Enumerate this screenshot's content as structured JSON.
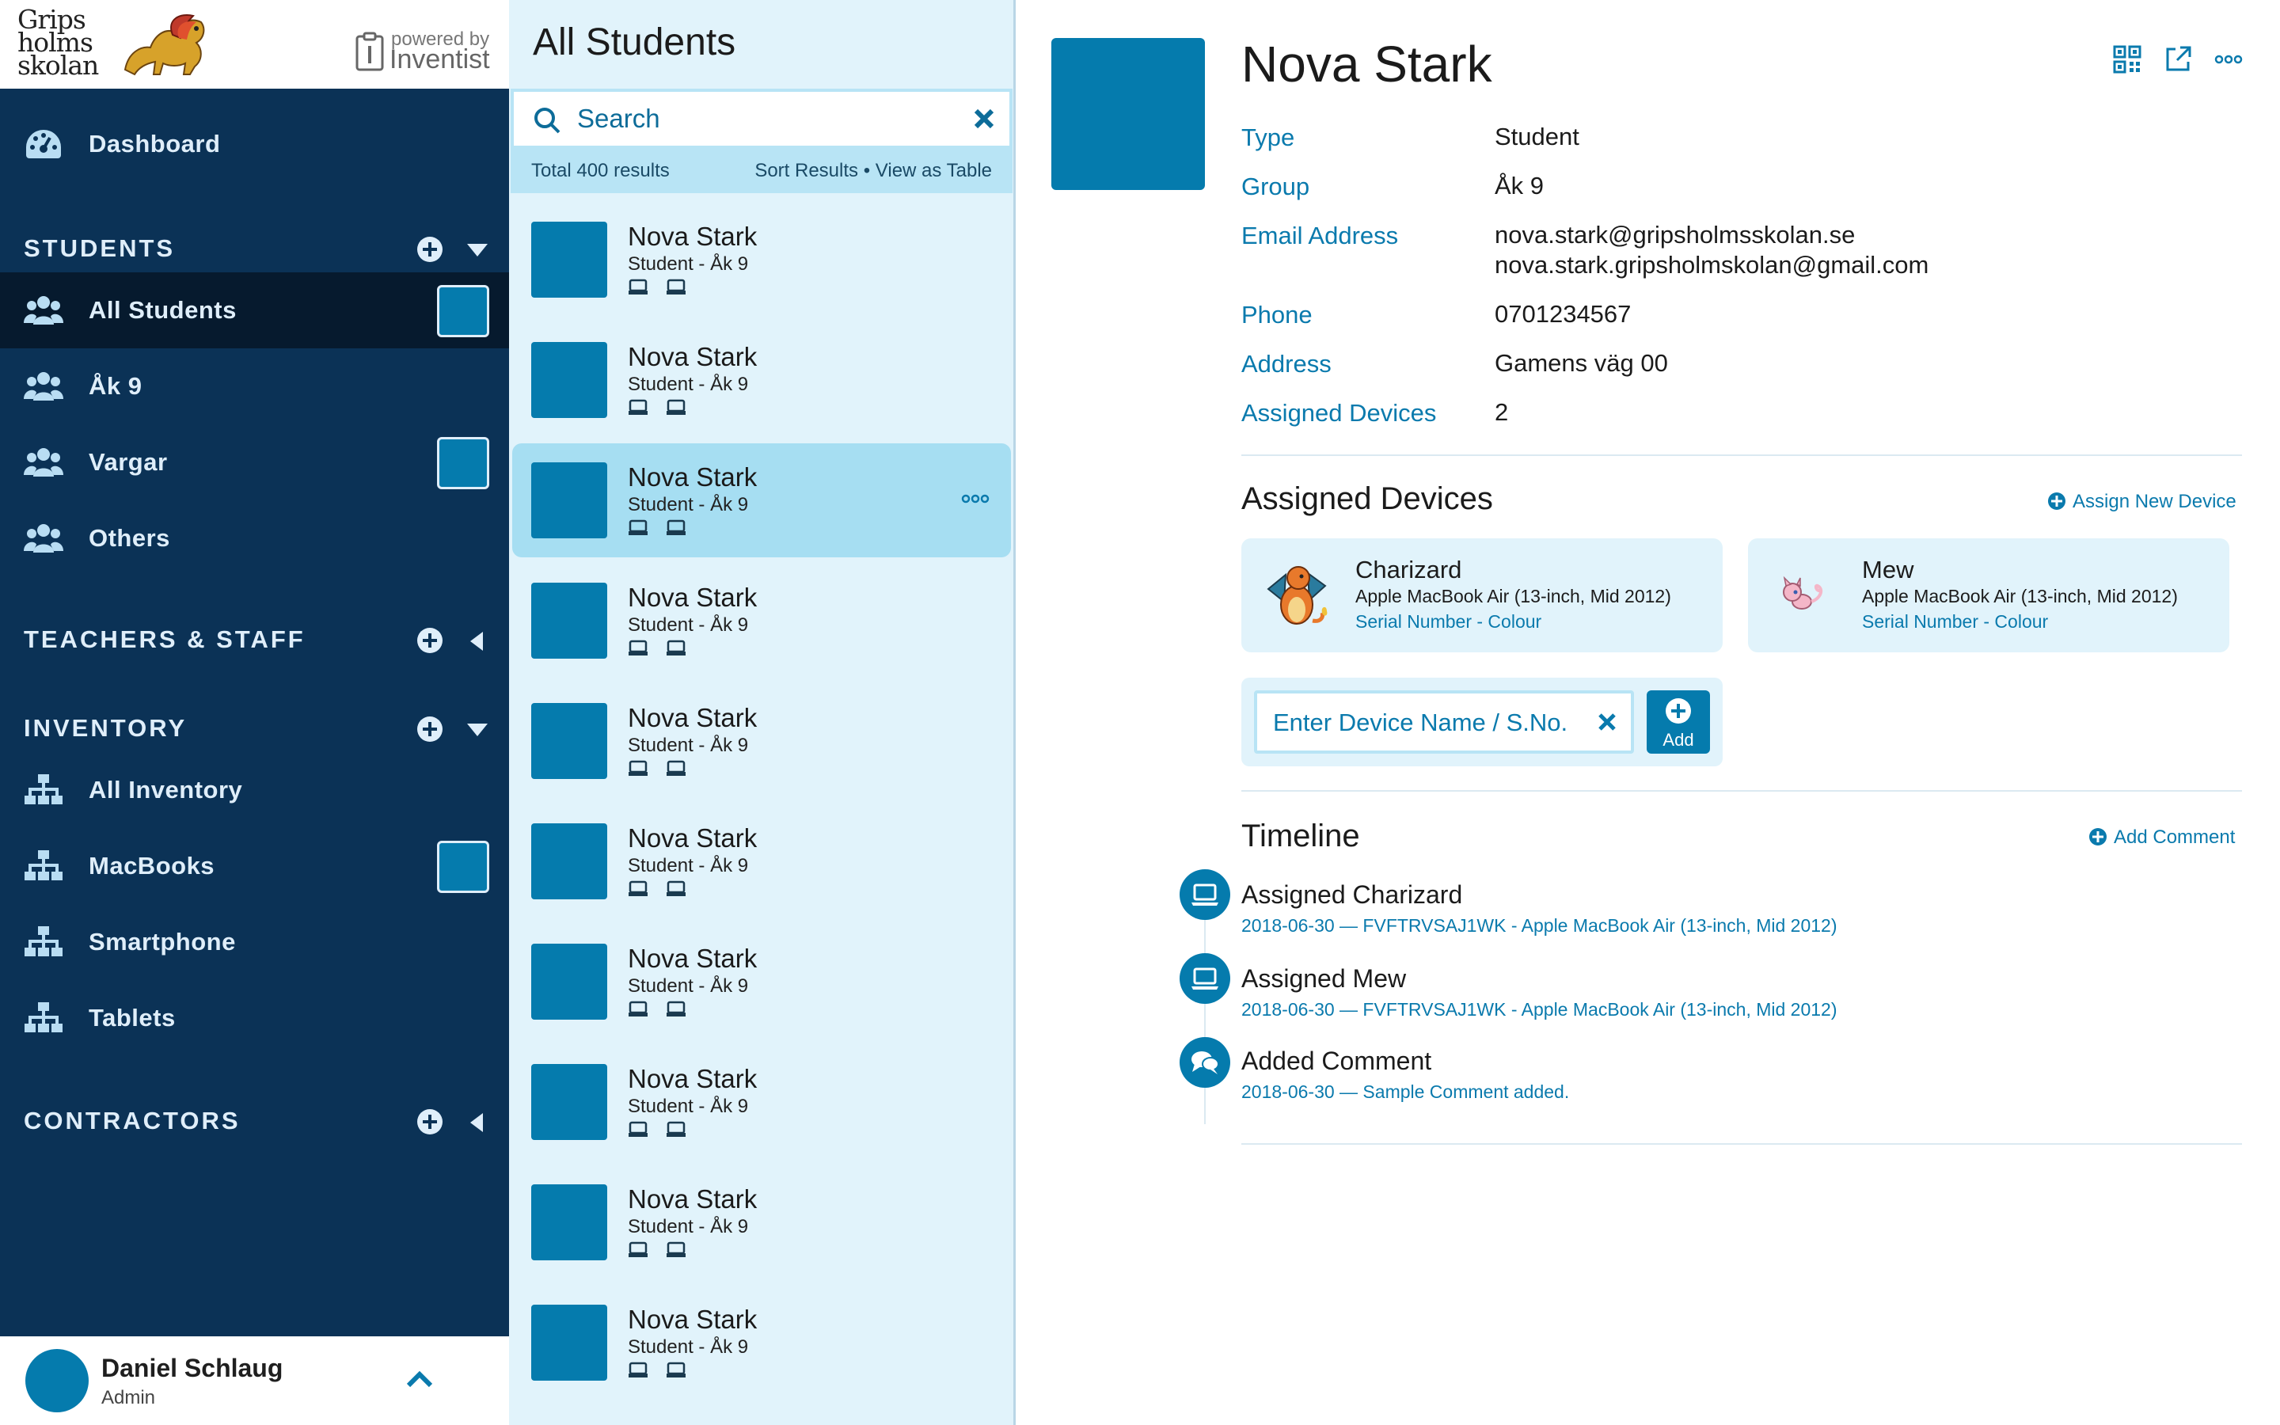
{
  "branding": {
    "school_line1": "Grips",
    "school_line2": "holms",
    "school_line3": "skolan",
    "powered_small": "powered by",
    "powered_big": "Inventist"
  },
  "sidebar": {
    "dashboard": "Dashboard",
    "sections": {
      "students": "STUDENTS",
      "teachers": "TEACHERS & STAFF",
      "inventory": "INVENTORY",
      "contractors": "CONTRACTORS"
    },
    "students_items": [
      "All Students",
      "Åk 9",
      "Vargar",
      "Others"
    ],
    "inventory_items": [
      "All Inventory",
      "MacBooks",
      "Smartphone",
      "Tablets"
    ]
  },
  "user": {
    "name": "Daniel Schlaug",
    "role": "Admin"
  },
  "list": {
    "title": "All Students",
    "search_placeholder": "Search",
    "total": "Total 400 results",
    "sort": "Sort Results",
    "separator": " • ",
    "view_table": "View as Table",
    "items": [
      {
        "name": "Nova Stark",
        "sub": "Student - Åk 9"
      },
      {
        "name": "Nova Stark",
        "sub": "Student - Åk 9"
      },
      {
        "name": "Nova Stark",
        "sub": "Student - Åk 9"
      },
      {
        "name": "Nova Stark",
        "sub": "Student - Åk 9"
      },
      {
        "name": "Nova Stark",
        "sub": "Student - Åk 9"
      },
      {
        "name": "Nova Stark",
        "sub": "Student - Åk 9"
      },
      {
        "name": "Nova Stark",
        "sub": "Student - Åk 9"
      },
      {
        "name": "Nova Stark",
        "sub": "Student - Åk 9"
      },
      {
        "name": "Nova Stark",
        "sub": "Student - Åk 9"
      },
      {
        "name": "Nova Stark",
        "sub": "Student - Åk 9"
      }
    ]
  },
  "detail": {
    "name": "Nova Stark",
    "fields": {
      "type_label": "Type",
      "type_value": "Student",
      "group_label": "Group",
      "group_value": "Åk 9",
      "email_label": "Email Address",
      "email_value_1": "nova.stark@gripsholmsskolan.se",
      "email_value_2": "nova.stark.gripsholmskolan@gmail.com",
      "phone_label": "Phone",
      "phone_value": "0701234567",
      "address_label": "Address",
      "address_value": "Gamens väg 00",
      "devices_label": "Assigned Devices",
      "devices_value": "2"
    },
    "assigned_title": "Assigned Devices",
    "assign_new": "Assign New Device",
    "devices": [
      {
        "name": "Charizard",
        "model": "Apple MacBook Air (13-inch, Mid 2012)",
        "meta": "Serial Number - Colour"
      },
      {
        "name": "Mew",
        "model": "Apple MacBook Air (13-inch, Mid 2012)",
        "meta": "Serial Number - Colour"
      }
    ],
    "assign_placeholder": "Enter Device Name / S.No.",
    "add_label": "Add",
    "timeline_title": "Timeline",
    "add_comment": "Add Comment",
    "timeline": [
      {
        "title": "Assigned Charizard",
        "sub": "2018-06-30 — FVFTRVSAJ1WK - Apple MacBook Air (13-inch, Mid 2012)",
        "icon": "laptop-icon"
      },
      {
        "title": "Assigned Mew",
        "sub": "2018-06-30 — FVFTRVSAJ1WK - Apple MacBook Air (13-inch, Mid 2012)",
        "icon": "laptop-icon"
      },
      {
        "title": "Added Comment",
        "sub": "2018-06-30 — Sample Comment added.",
        "icon": "comment-icon"
      }
    ]
  },
  "colors": {
    "sidebar_bg": "#0b3256",
    "sidebar_active": "#061a2e",
    "accent": "#057bad",
    "list_bg": "#e1f3fb",
    "selected_bg": "#a6def2",
    "link": "#0a7aad"
  }
}
